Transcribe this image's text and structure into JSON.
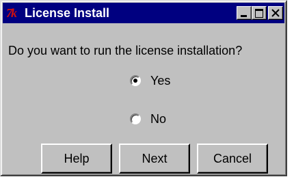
{
  "window": {
    "title": "License Install",
    "app_icon_text": "7k",
    "controls": [
      "minimize-icon",
      "maximize-icon",
      "close-icon"
    ]
  },
  "dialog": {
    "question": "Do you want to run the license installation?",
    "options": [
      {
        "label": "Yes",
        "selected": true
      },
      {
        "label": "No",
        "selected": false
      }
    ]
  },
  "buttons": {
    "help": "Help",
    "next": "Next",
    "cancel": "Cancel"
  },
  "colors": {
    "titlebar": "#000080",
    "face": "#c0c0c0",
    "title_text": "#ffffff"
  }
}
